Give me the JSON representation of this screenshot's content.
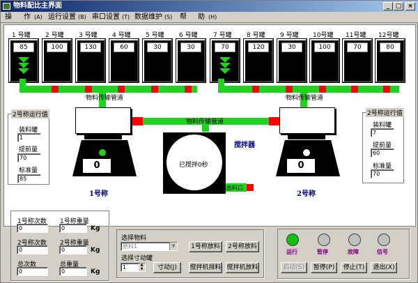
{
  "window": {
    "title": "物料配比主界面"
  },
  "menu": [
    {
      "label": "操"
    },
    {
      "label": "作"
    },
    {
      "label": "(A)"
    },
    {
      "label": "运行设置"
    },
    {
      "label": "(B)"
    },
    {
      "label": "串口设置"
    },
    {
      "label": "(T)"
    },
    {
      "label": "数据维护"
    },
    {
      "label": "(S)"
    },
    {
      "label": "帮"
    },
    {
      "label": "助"
    },
    {
      "label": "(H)"
    }
  ],
  "tanks": [
    {
      "label": "1 号罐",
      "value": "85",
      "flowing": true
    },
    {
      "label": "2 号罐",
      "value": "100",
      "flowing": false
    },
    {
      "label": "3 号罐",
      "value": "130",
      "flowing": false
    },
    {
      "label": "4 号罐",
      "value": "60",
      "flowing": false
    },
    {
      "label": "5 号罐",
      "value": "30",
      "flowing": false
    },
    {
      "label": "6 号罐",
      "value": "30",
      "flowing": false
    },
    {
      "label": "7 号罐",
      "value": "70",
      "flowing": true
    },
    {
      "label": "8 号罐",
      "value": "120",
      "flowing": false
    },
    {
      "label": "9 号罐",
      "value": "30",
      "flowing": false
    },
    {
      "label": "10号罐",
      "value": "100",
      "flowing": false
    },
    {
      "label": "11号罐",
      "value": "70",
      "flowing": false
    },
    {
      "label": "12号罐",
      "value": "80",
      "flowing": false
    }
  ],
  "pipes": {
    "left_label": "物料传输管道",
    "right_label": "物料传输管道",
    "center_label": "物料传输管道"
  },
  "scale1": {
    "weight": "0",
    "unit": "Kg",
    "name": "1号称"
  },
  "scale2": {
    "weight": "0",
    "unit": "Kg",
    "name": "2号称"
  },
  "mixer": {
    "title": "搅拌器",
    "status": "已搅拌0秒",
    "outlet": "出料口"
  },
  "run1": {
    "title": "2号称运行值",
    "f1_label": "装料罐",
    "f1_value": "1",
    "f2_label": "提前量",
    "f2_value": "70",
    "f3_label": "标准量",
    "f3_value": "85"
  },
  "run2": {
    "title": "2号称运行值",
    "f1_label": "装料罐",
    "f1_value": "7",
    "f2_label": "提前量",
    "f2_value": "60",
    "f3_label": "标准量",
    "f3_value": "70"
  },
  "stats": {
    "s1_count_label": "1号称次数",
    "s1_count": "0",
    "s1_weight_label": "1号称重量",
    "s1_weight": "0",
    "s2_count_label": "2号称次数",
    "s2_count": "0",
    "s2_weight_label": "2号称重量",
    "s2_weight": "0",
    "total_count_label": "总次数",
    "total_count": "0",
    "total_weight_label": "总重量",
    "total_weight": "0",
    "unit": "Kg"
  },
  "select": {
    "title": "选择物料",
    "material": "原料1",
    "jog_label": "选择寸动罐",
    "jog_value": "1",
    "jog_button": "寸动(J)",
    "discharge1": "1号称放料",
    "discharge2": "2号称放料",
    "mixer_discharge": "搅拌机排料",
    "mixer_release": "搅拌机放料"
  },
  "status": {
    "run_label": "运行",
    "pause_label": "暂停",
    "fault_label": "故障",
    "signal_label": "信号",
    "run_color": "#11c011",
    "pause_color": "#c0c0c0",
    "fault_color": "#c0c0c0",
    "signal_color": "#c0c0c0"
  },
  "controls": {
    "start": "启动(S)",
    "pause": "暂停(P)",
    "stop": "停止(T)",
    "exit": "退出(X)"
  },
  "colors": {
    "pipe": "#1fd41f",
    "valve_open": "#1fd41f",
    "valve_closed": "#ff0000",
    "titlebar": "#0a246a"
  }
}
